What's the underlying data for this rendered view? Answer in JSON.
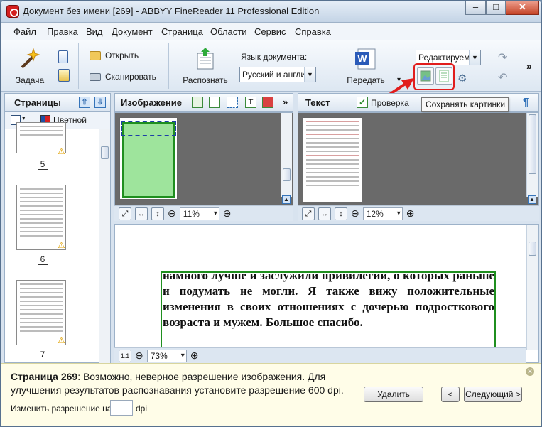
{
  "window": {
    "title": "Документ без имени [269] - ABBYY FineReader 11 Professional Edition",
    "controls": {
      "minimize": "–",
      "maximize": "□",
      "close": "✕"
    }
  },
  "menu": [
    "Файл",
    "Правка",
    "Вид",
    "Документ",
    "Страница",
    "Области",
    "Сервис",
    "Справка"
  ],
  "toolbar": {
    "task_label": "Задача",
    "open_label": "Открыть",
    "scan_label": "Сканировать",
    "recognize_label": "Распознать",
    "lang_label": "Язык документа:",
    "lang_value": "Русский и англи",
    "send_label": "Передать",
    "send_arrow": "▾",
    "mode_value": "Редактируема",
    "more": "»"
  },
  "tooltip": {
    "text": "Сохранять картинки"
  },
  "pages_panel": {
    "title": "Страницы",
    "color_label": "Цветной",
    "page_numbers": [
      "5",
      "6",
      "7"
    ]
  },
  "image_panel": {
    "title": "Изображение",
    "more": "»",
    "zoom": "11%"
  },
  "text_panel": {
    "title": "Текст",
    "check_label": "Проверка",
    "zoom": "12%"
  },
  "editor": {
    "zoom": "73%",
    "ratio_label": "1:1",
    "text": "намного лучше и заслужили привилегии, о которых раньше и подумать не могли. Я также вижу положительные изменения в своих отношениях с дочерью подросткового возраста и мужем. Большое спасибо."
  },
  "warning": {
    "page_label": "Страница 269",
    "message": ": Возможно, неверное разрешение изображения. Для улучшения результатов распознавания установите разрешение 600 dpi.",
    "change_res_label": "Изменить разрешение на:",
    "dpi_unit": "dpi",
    "delete_button": "Удалить",
    "prev_button": "<",
    "next_button": "Следующий >"
  },
  "colors": {
    "highlight": "#e11d1d",
    "accent": "#1f8f1f",
    "title_bg": "#dce6f1"
  }
}
